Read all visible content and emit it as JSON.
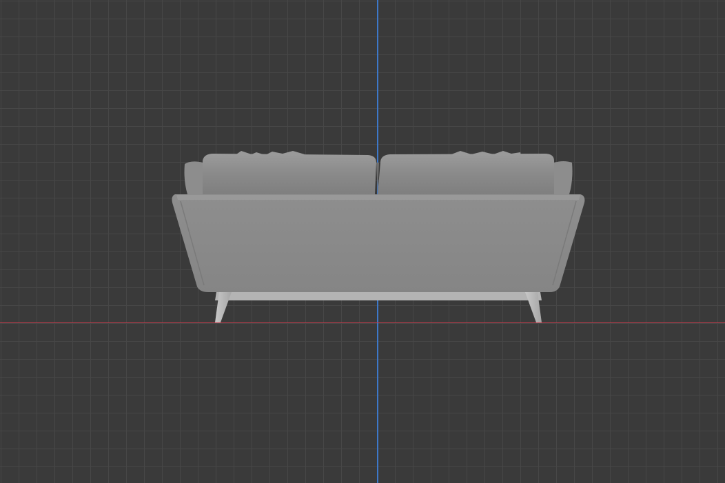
{
  "viewport": {
    "grid_color": "#474747",
    "background_color": "#3a3a3a",
    "axis_x_color": "#c23b4b",
    "axis_z_color": "#3d78c9",
    "object_color": "#8c8c8c"
  },
  "icons": {
    "object": "sofa-model"
  }
}
